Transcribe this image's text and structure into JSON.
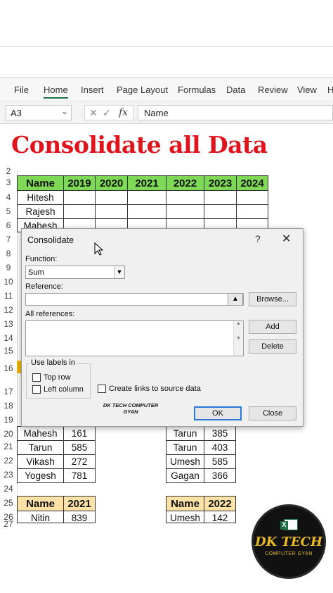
{
  "ribbon": {
    "tabs": [
      "File",
      "Home",
      "Insert",
      "Page Layout",
      "Formulas",
      "Data",
      "Review",
      "View",
      "H"
    ]
  },
  "formula_bar": {
    "name_box": "A3",
    "fx": "fx",
    "value": "Name"
  },
  "banner": "Consolidate all Data",
  "row_numbers": [
    "2",
    "3",
    "4",
    "5",
    "6",
    "7",
    "8",
    "9",
    "10",
    "11",
    "12",
    "13",
    "14",
    "15",
    "16",
    "17",
    "18",
    "19",
    "20",
    "21",
    "22",
    "23",
    "24",
    "25",
    "26",
    "27"
  ],
  "main_table": {
    "headers": [
      "Name",
      "2019",
      "2020",
      "2021",
      "2022",
      "2023",
      "2024"
    ],
    "names": [
      "Hitesh",
      "Rajesh",
      "Mahesh"
    ]
  },
  "left_table": {
    "rows": [
      [
        "Mahesh",
        "161"
      ],
      [
        "Tarun",
        "585"
      ],
      [
        "Vikash",
        "272"
      ],
      [
        "Yogesh",
        "781"
      ]
    ]
  },
  "right_table": {
    "rows": [
      [
        "Tarun",
        "385"
      ],
      [
        "Tarun",
        "403"
      ],
      [
        "Umesh",
        "585"
      ],
      [
        "Gagan",
        "366"
      ]
    ]
  },
  "bottom_left": {
    "headers": [
      "Name",
      "2021"
    ],
    "row": [
      "Nitin",
      "839"
    ]
  },
  "bottom_right": {
    "headers": [
      "Name",
      "2022"
    ],
    "row": [
      "Umesh",
      "142"
    ]
  },
  "dialog": {
    "title": "Consolidate",
    "help": "?",
    "close": "✕",
    "function_label": "Function:",
    "function_value": "Sum",
    "reference_label": "Reference:",
    "reference_value": "",
    "browse": "Browse...",
    "all_references_label": "All references:",
    "add": "Add",
    "delete": "Delete",
    "use_labels": "Use labels in",
    "top_row": "Top row",
    "left_column": "Left column",
    "create_links": "Create links to source data",
    "ok": "OK",
    "close_btn": "Close",
    "watermark_line1": "DK TECH COMPUTER",
    "watermark_line2": "GYAN"
  },
  "logo": {
    "main": "DK TECH",
    "sub": "COMPUTER GYAN",
    "icon": "excel-icon"
  },
  "colors": {
    "header_green": "#7ed957",
    "header_yellow": "#fde2a7",
    "banner_red": "#e0141c",
    "accent_blue": "#2b79d6"
  }
}
